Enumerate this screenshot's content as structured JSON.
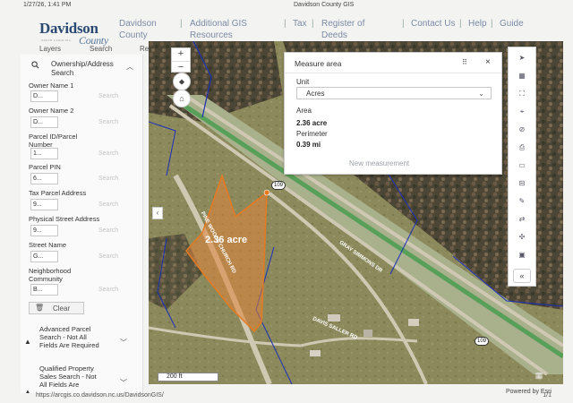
{
  "print": {
    "datetime": "1/27/26, 1:41 PM",
    "page_title": "Davidson County GIS",
    "url": "https://arcgis.co.davidson.nc.us/DavidsonGIS/",
    "page_num": "1/1"
  },
  "header": {
    "logo_main": "Davidson",
    "logo_county": "County",
    "logo_sub": "NORTH CAROLINA",
    "nav": [
      "Davidson County",
      "Additional GIS Resources",
      "Tax",
      "Register of Deeds",
      "Contact Us",
      "Help",
      "Guide"
    ]
  },
  "tabs": [
    "Layers",
    "Search",
    "Re"
  ],
  "search_panel": {
    "title": "Ownership/Address Search",
    "search_label": "Search",
    "fields": [
      {
        "label": "Owner Name 1",
        "value": "D..."
      },
      {
        "label": "Owner Name 2",
        "value": "D..."
      },
      {
        "label": "Parcel ID/Parcel Number",
        "value": "1..."
      },
      {
        "label": "Parcel PIN",
        "value": "6..."
      },
      {
        "label": "Tax Parcel Address",
        "value": "9..."
      },
      {
        "label": "Physical Street Address",
        "value": "9..."
      },
      {
        "label": "Street Name",
        "value": "G..."
      },
      {
        "label": "Neighborhood Community",
        "value": "B..."
      }
    ],
    "clear_label": "Clear",
    "advanced": "Advanced Parcel Search - Not All Fields Are Required",
    "qualified": "Qualified Property Sales Search - Not All Fields Are"
  },
  "measure": {
    "title": "Measure area",
    "unit_label": "Unit",
    "unit_value": "Acres",
    "area_label": "Area",
    "area_value": "2.36 acre",
    "perimeter_label": "Perimeter",
    "perimeter_value": "0.39 mi",
    "new_label": "New measurement"
  },
  "map": {
    "parcel_label": "2.36 acre",
    "scale_label": "200 ft",
    "powered_by": "Powered by Esri",
    "highway_number": "109",
    "road_labels": [
      "PINE WOODS CHURCH RD",
      "GRAY SIMMONS DR",
      "DAVIS SALLER RD"
    ]
  },
  "colors": {
    "parcel_fill": "#e0843b",
    "parcel_stroke": "#e67a22",
    "boundary": "#1c2fb8",
    "road": "#cfc9b3",
    "highway_green": "#58a05a"
  }
}
